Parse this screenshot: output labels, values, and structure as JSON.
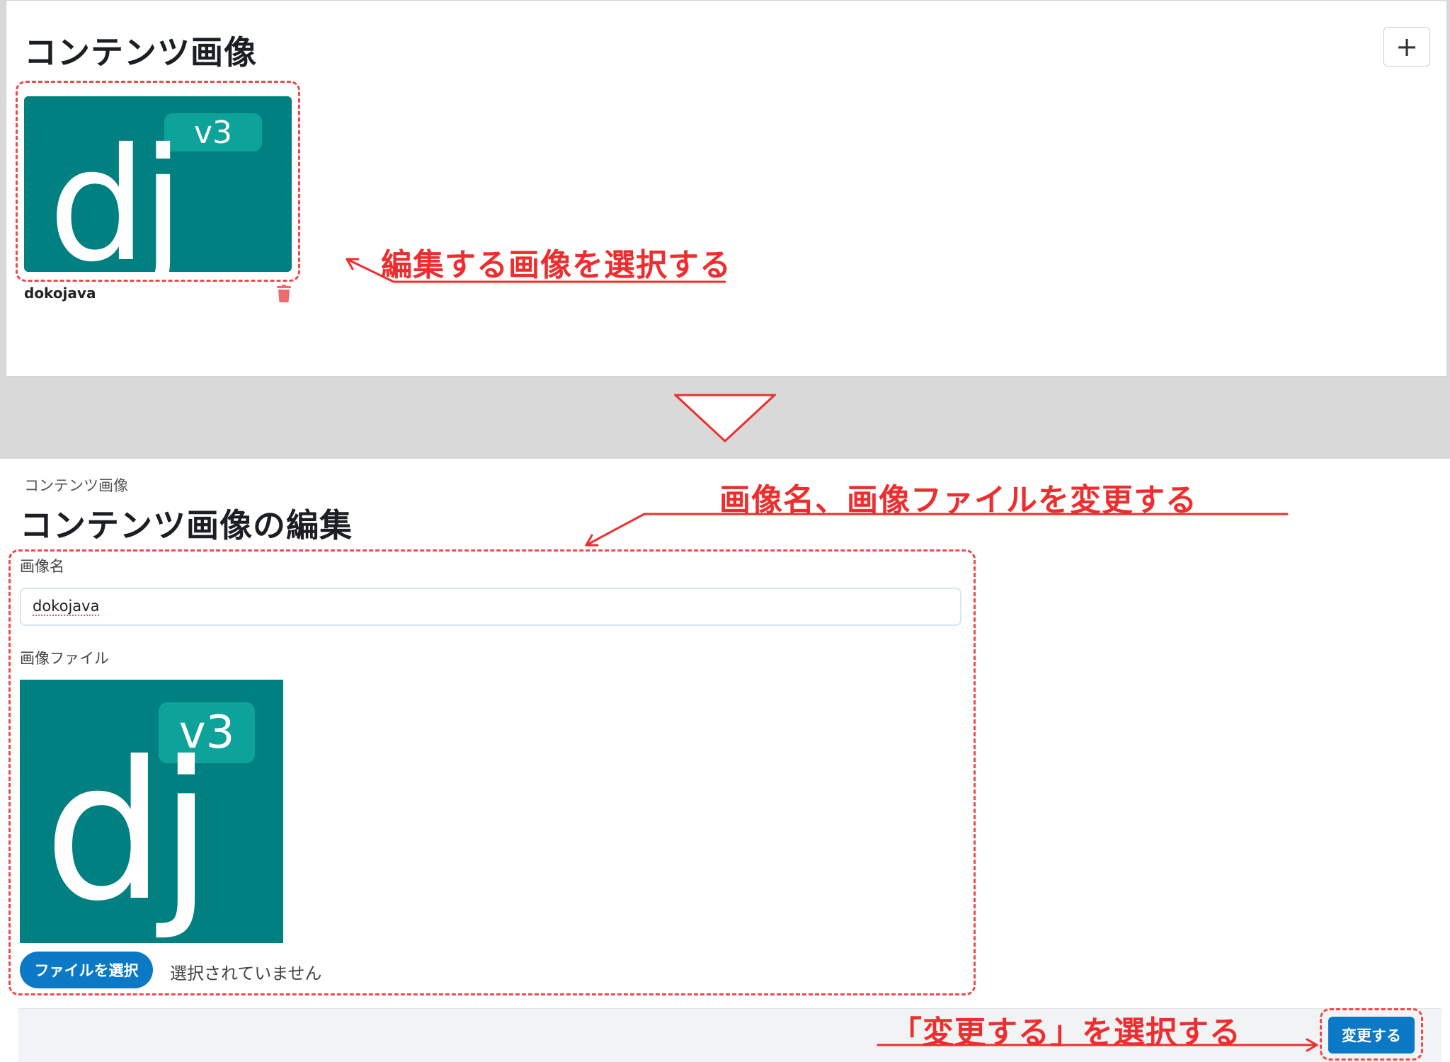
{
  "top": {
    "title": "コンテンツ画像",
    "add_icon": "plus-icon",
    "item": {
      "badge": "v3",
      "logo_text": "dj",
      "caption": "dokojava",
      "delete_icon": "trash-icon"
    },
    "annotation": "編集する画像を選択する"
  },
  "divider": {
    "icon": "triangle-down-icon"
  },
  "edit": {
    "breadcrumb": "コンテンツ画像",
    "title": "コンテンツ画像の編集",
    "annotation_fields": "画像名、画像ファイルを変更する",
    "name_label": "画像名",
    "name_value": "dokojava",
    "file_label": "画像ファイル",
    "preview_badge": "v3",
    "preview_logo_text": "dj",
    "file_button": "ファイルを選択",
    "file_status": "選択されていません",
    "annotation_submit": "「変更する」を選択する",
    "submit_button": "変更する"
  },
  "colors": {
    "annotation": "#ee2e2e",
    "logo_bg": "#008080",
    "badge_bg": "#0ea39a",
    "primary": "#0b79c5"
  }
}
